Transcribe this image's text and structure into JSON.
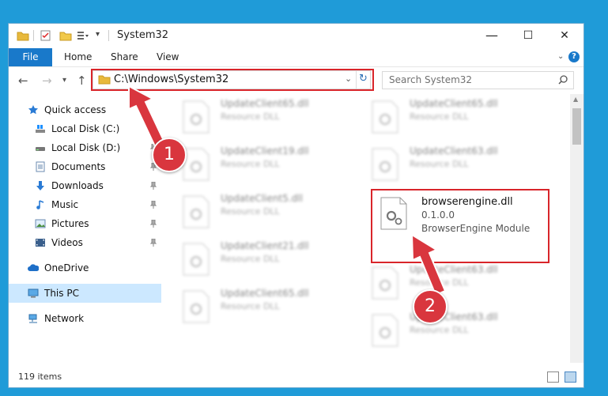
{
  "window": {
    "title": "System32"
  },
  "controls": {
    "minimize": "—",
    "maximize": "☐",
    "close": "✕"
  },
  "ribbon": {
    "file": "File",
    "tabs": [
      "Home",
      "Share",
      "View"
    ],
    "help": "?"
  },
  "address": {
    "path": "C:\\Windows\\System32",
    "search_placeholder": "Search System32"
  },
  "nav": {
    "quick_access": "Quick access",
    "items": [
      {
        "label": "Local Disk (C:)",
        "pinned": false
      },
      {
        "label": "Local Disk (D:)",
        "pinned": true
      },
      {
        "label": "Documents",
        "pinned": true
      },
      {
        "label": "Downloads",
        "pinned": true
      },
      {
        "label": "Music",
        "pinned": true
      },
      {
        "label": "Pictures",
        "pinned": true
      },
      {
        "label": "Videos",
        "pinned": true
      }
    ],
    "onedrive": "OneDrive",
    "this_pc": "This PC",
    "network": "Network"
  },
  "files": {
    "left": [
      {
        "name": "UpdateClient65.dll",
        "type": "Resource DLL"
      },
      {
        "name": "UpdateClient19.dll",
        "type": "Resource DLL"
      },
      {
        "name": "UpdateClient5.dll",
        "type": "Resource DLL"
      },
      {
        "name": "UpdateClient21.dll",
        "type": "Resource DLL"
      },
      {
        "name": "UpdateClient65.dll",
        "type": "Resource DLL"
      }
    ],
    "right": [
      {
        "name": "UpdateClient65.dll",
        "type": "Resource DLL"
      },
      {
        "name": "UpdateClient63.dll",
        "type": "Resource DLL"
      },
      {
        "name": "UpdateClient63.dll",
        "type": "Resource DLL"
      },
      {
        "name": "UpdateClient63.dll",
        "type": "Resource DLL"
      }
    ],
    "highlighted": {
      "name": "browserengine.dll",
      "version": "0.1.0.0",
      "type": "BrowserEngine Module"
    }
  },
  "status": {
    "items": "119 items"
  },
  "annotations": {
    "step1": "1",
    "step2": "2"
  },
  "colors": {
    "accent": "#1979ca",
    "highlight": "#d9252a",
    "badge": "#d9363e"
  }
}
